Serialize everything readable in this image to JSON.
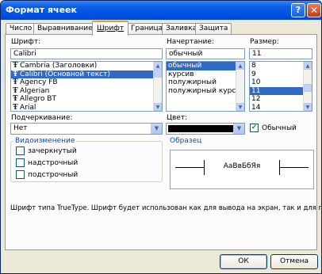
{
  "window": {
    "title": "Формат ячеек",
    "help_icon": "question-icon",
    "close_icon": "close-icon"
  },
  "tabs": [
    {
      "label": "Число",
      "active": false
    },
    {
      "label": "Выравнивание",
      "active": false
    },
    {
      "label": "Шрифт",
      "active": true
    },
    {
      "label": "Граница",
      "active": false
    },
    {
      "label": "Заливка",
      "active": false
    },
    {
      "label": "Защита",
      "active": false
    }
  ],
  "font": {
    "label": "Шрифт:",
    "value": "Calibri",
    "items": [
      "Cambria (Заголовки)",
      "Calibri (Основной текст)",
      "Agency FB",
      "Algerian",
      "Allegro BT",
      "Arial"
    ],
    "selected_index": 1,
    "item_icon": "truetype-icon"
  },
  "style": {
    "label": "Начертание:",
    "value": "обычный",
    "items": [
      "обычный",
      "курсив",
      "полужирный",
      "полужирный курсив"
    ],
    "selected_index": 0
  },
  "size": {
    "label": "Размер:",
    "value": "11",
    "items": [
      "8",
      "9",
      "10",
      "11",
      "12",
      "14"
    ],
    "selected_index": 3
  },
  "underline": {
    "label": "Подчеркивание:",
    "value": "Нет"
  },
  "color": {
    "label": "Цвет:",
    "value_color": "#000000",
    "normal_label": "Обычный",
    "normal_checked": true
  },
  "effects": {
    "title": "Видоизменение",
    "items": [
      {
        "label": "зачеркнутый",
        "checked": false
      },
      {
        "label": "надстрочный",
        "checked": false
      },
      {
        "label": "подстрочный",
        "checked": false
      }
    ]
  },
  "sample": {
    "title": "Образец",
    "text": "АаВвБбЯя"
  },
  "info_text": "Шрифт типа TrueType. Шрифт будет использован как для вывода на экран, так и для печати.",
  "buttons": {
    "ok": "ОК",
    "cancel": "Отмена"
  }
}
